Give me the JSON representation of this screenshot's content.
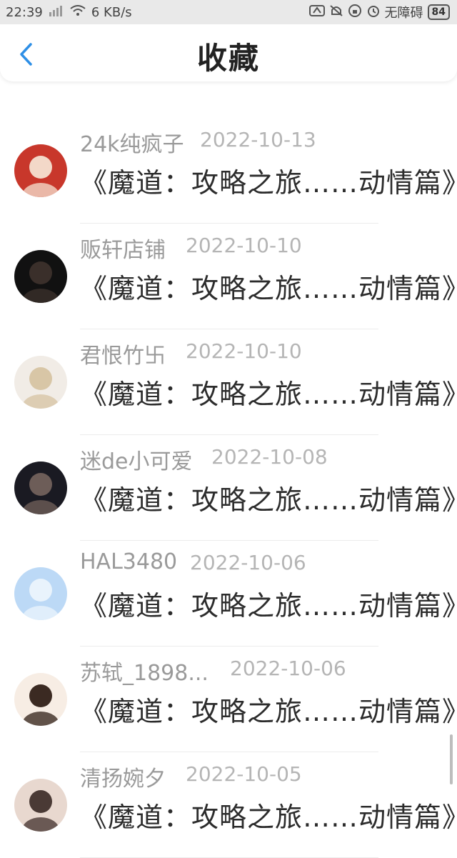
{
  "status_bar": {
    "time": "22:39",
    "network_speed": "6 KB/s",
    "accessibility_label": "无障碍",
    "battery": "84",
    "icons": [
      "signal-icon",
      "wifi-icon",
      "app-icon",
      "bell-off-icon",
      "lock-rotation-icon",
      "alarm-icon"
    ]
  },
  "header": {
    "title": "收藏",
    "back_icon": "chevron-left-icon",
    "accent_color": "#2e8fe6"
  },
  "favorites": [
    {
      "username": "",
      "date": "",
      "title": "《魔道：攻略之旅……动情篇》",
      "avatar_colors": [
        "#6b5f52",
        "#d9c4b0"
      ]
    },
    {
      "username": "24k纯疯子",
      "date": "2022-10-13",
      "title": "《魔道：攻略之旅……动情篇》",
      "avatar_colors": [
        "#c8372b",
        "#f3d8c8"
      ]
    },
    {
      "username": "贩轩店铺",
      "date": "2022-10-10",
      "title": "《魔道：攻略之旅……动情篇》",
      "avatar_colors": [
        "#111111",
        "#3a2f2a"
      ]
    },
    {
      "username": "君恨竹卐",
      "date": "2022-10-10",
      "title": "《魔道：攻略之旅……动情篇》",
      "avatar_colors": [
        "#f1ece6",
        "#d8c6a6"
      ]
    },
    {
      "username": "迷de小可爱",
      "date": "2022-10-08",
      "title": "《魔道：攻略之旅……动情篇》",
      "avatar_colors": [
        "#1a1a22",
        "#6d5d58"
      ]
    },
    {
      "username": "HAL3480",
      "date": "2022-10-06",
      "title": "《魔道：攻略之旅……动情篇》",
      "avatar_colors": [
        "#bcd9f6",
        "#e9f3fc"
      ]
    },
    {
      "username": "苏轼_1898...",
      "date": "2022-10-06",
      "title": "《魔道：攻略之旅……动情篇》",
      "avatar_colors": [
        "#f7ede4",
        "#3b2a22"
      ]
    },
    {
      "username": "清扬婉夕",
      "date": "2022-10-05",
      "title": "《魔道：攻略之旅……动情篇》",
      "avatar_colors": [
        "#e8d8cf",
        "#4a3a35"
      ]
    }
  ]
}
